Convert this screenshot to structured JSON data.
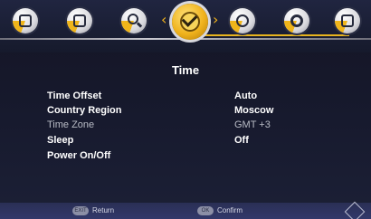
{
  "nav": {
    "icons": [
      "picture-icon",
      "image-icon",
      "search-icon",
      "clock-icon",
      "channel-icon",
      "settings-gear-icon",
      "lock-icon"
    ],
    "selected": "clock-icon",
    "accent_color": "#f0b21c"
  },
  "page": {
    "title": "Time"
  },
  "menu": [
    {
      "label": "Time Offset",
      "value": "Auto"
    },
    {
      "label": "Country Region",
      "value": "Moscow"
    },
    {
      "label": "Time Zone",
      "value": "GMT +3"
    },
    {
      "label": "Sleep",
      "value": "Off"
    },
    {
      "label": "Power On/Off",
      "value": ""
    }
  ],
  "footer": {
    "return_key": "EXIT",
    "return_label": "Return",
    "confirm_key": "OK",
    "confirm_label": "Confirm"
  }
}
